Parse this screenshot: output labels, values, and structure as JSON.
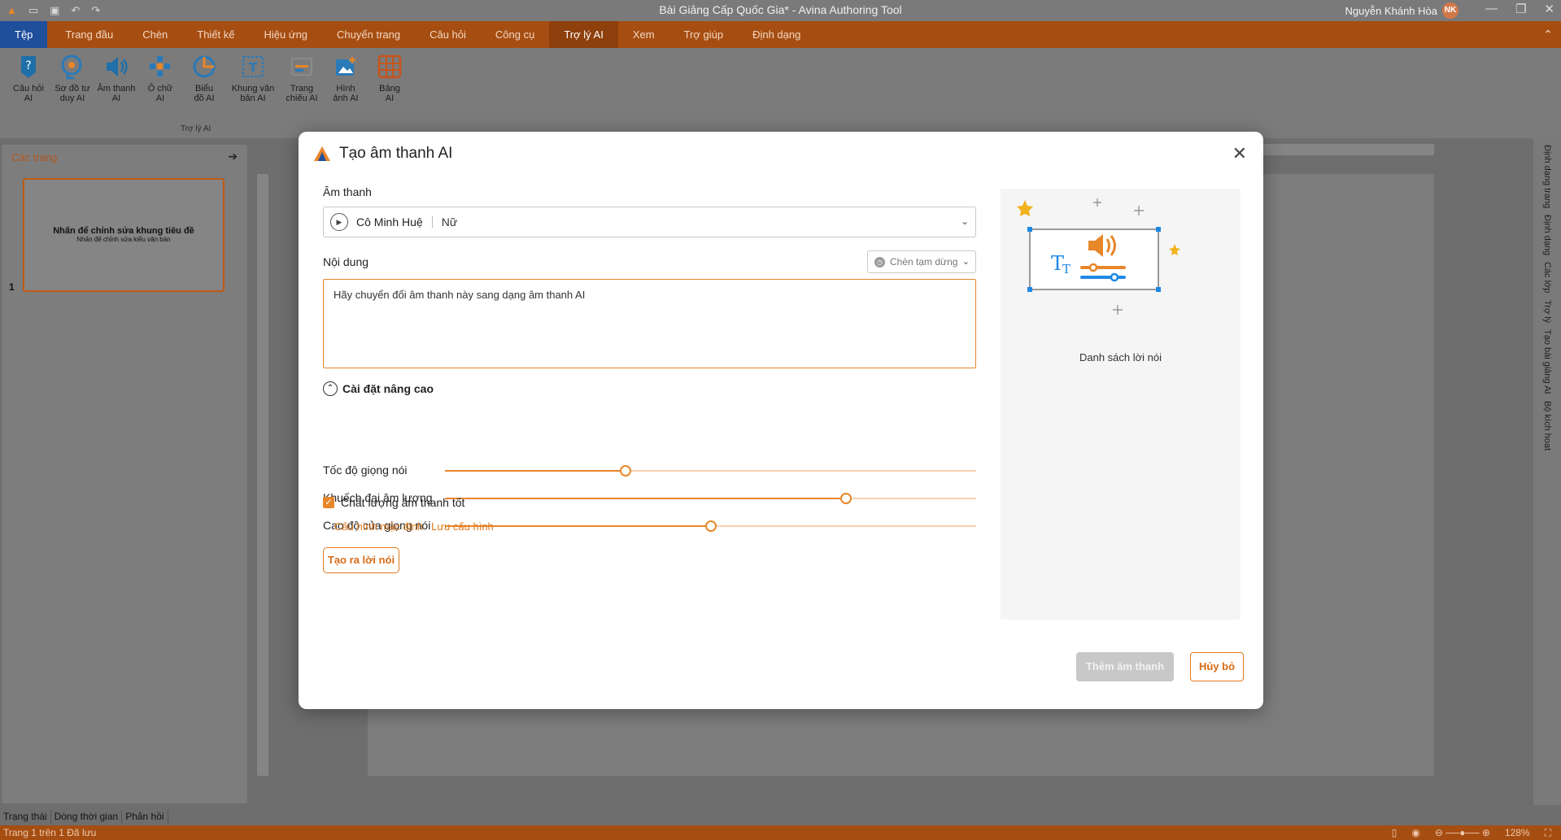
{
  "window": {
    "title": "Bài Giảng Cấp Quốc Gia* - Avina Authoring Tool",
    "user_name": "Nguyễn Khánh Hòa",
    "user_initials": "NK"
  },
  "menu": {
    "tabs": [
      "Tệp",
      "Trang đầu",
      "Chèn",
      "Thiết kế",
      "Hiệu ứng",
      "Chuyển trang",
      "Câu hỏi",
      "Công cụ",
      "Trợ lý AI",
      "Xem",
      "Trợ giúp",
      "Định dạng"
    ],
    "active": "Trợ lý AI"
  },
  "ribbon": {
    "buttons": [
      {
        "line1": "Câu hỏi",
        "line2": "AI",
        "icon": "question-ai-icon"
      },
      {
        "line1": "Sơ đồ tư",
        "line2": "duy AI",
        "icon": "mindmap-ai-icon"
      },
      {
        "line1": "Âm thanh",
        "line2": "AI",
        "icon": "audio-ai-icon"
      },
      {
        "line1": "Ô chữ",
        "line2": "AI",
        "icon": "crossword-ai-icon"
      },
      {
        "line1": "Biểu",
        "line2": "đồ AI",
        "icon": "chart-ai-icon"
      },
      {
        "line1": "Khung văn",
        "line2": "bản AI",
        "icon": "textbox-ai-icon"
      },
      {
        "line1": "Trang",
        "line2": "chiếu AI",
        "icon": "slide-ai-icon"
      },
      {
        "line1": "Hình",
        "line2": "ảnh AI",
        "icon": "image-ai-icon"
      },
      {
        "line1": "Bảng",
        "line2": "AI",
        "icon": "table-ai-icon"
      }
    ],
    "group_label": "Trợ lý AI"
  },
  "pages_panel": {
    "title": "Các trang",
    "slide_number": "1",
    "thumb_title": "Nhấn để chỉnh sửa khung tiêu đề",
    "thumb_sub": "Nhấn để chỉnh sửa kiểu văn bản"
  },
  "right_sidebar": {
    "tabs": [
      "Định dạng trang",
      "Định dạng",
      "Các lớp",
      "Trợ lý",
      "Tạo bài giảng AI",
      "Bộ kích hoạt"
    ]
  },
  "bottom_tabs": [
    "Trạng thái",
    "Dòng thời gian",
    "Phản hồi"
  ],
  "status": {
    "left": "Trang 1 trên 1     Đã lưu",
    "zoom": "128%"
  },
  "dialog": {
    "title": "Tạo âm thanh AI",
    "voice_label": "Âm thanh",
    "voice_name": "Cô Minh Huệ",
    "voice_gender": "Nữ",
    "content_label": "Nội dung",
    "pause_dropdown": "Chèn tạm dừng",
    "content_value": "Hãy chuyển đổi âm thanh này sang dạng âm thanh AI",
    "advanced_label": "Cài đặt nâng cao",
    "sliders": [
      {
        "label": "Tốc độ giọng nói",
        "value_pct": 34
      },
      {
        "label": "Khuếch đại âm lượng",
        "value_pct": 75.5
      },
      {
        "label": "Cao độ của giọng nói",
        "value_pct": 50
      }
    ],
    "quality_label": "Chất lượng âm thanh tốt",
    "quality_checked": true,
    "link_default": "Cấu hình mặc định",
    "link_save": "Lưu cấu hình",
    "generate_button": "Tạo ra lời nói",
    "preview_text": "Danh sách lời nói",
    "add_button": "Thêm âm thanh",
    "cancel_button": "Hủy bỏ"
  },
  "colors": {
    "accent": "#e8862a",
    "menubar": "#a64e12",
    "file_tab": "#1f4e9b"
  }
}
